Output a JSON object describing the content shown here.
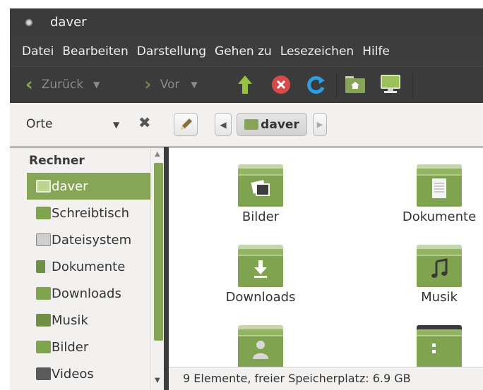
{
  "window": {
    "title": "daver"
  },
  "menu": [
    "Datei",
    "Bearbeiten",
    "Darstellung",
    "Gehen zu",
    "Lesezeichen",
    "Hilfe"
  ],
  "toolbar": {
    "back_label": "Zurück",
    "forward_label": "Vor"
  },
  "location": {
    "places_label": "Orte",
    "crumb": "daver"
  },
  "sidebar": {
    "header": "Rechner",
    "items": [
      {
        "label": "daver",
        "icon": "home-folder-icon",
        "active": true
      },
      {
        "label": "Schreibtisch",
        "icon": "desktop-icon"
      },
      {
        "label": "Dateisystem",
        "icon": "drive-icon"
      },
      {
        "label": "Dokumente",
        "icon": "documents-folder-icon"
      },
      {
        "label": "Downloads",
        "icon": "downloads-folder-icon"
      },
      {
        "label": "Musik",
        "icon": "music-folder-icon"
      },
      {
        "label": "Bilder",
        "icon": "pictures-folder-icon"
      },
      {
        "label": "Videos",
        "icon": "videos-folder-icon"
      }
    ]
  },
  "files": [
    {
      "label": "Bilder",
      "icon": "pictures-folder-icon"
    },
    {
      "label": "Dokumente",
      "icon": "documents-folder-icon"
    },
    {
      "label": "Downloads",
      "icon": "downloads-folder-icon"
    },
    {
      "label": "Musik",
      "icon": "music-folder-icon"
    },
    {
      "label": "",
      "icon": "public-folder-icon"
    },
    {
      "label": "",
      "icon": "templates-folder-icon"
    }
  ],
  "status": {
    "text": "9 Elemente, freier Speicherplatz: 6.9 GB"
  },
  "colors": {
    "accent": "#87a556",
    "titlebar": "#3b3b3b",
    "panel": "#f2f1f0"
  }
}
